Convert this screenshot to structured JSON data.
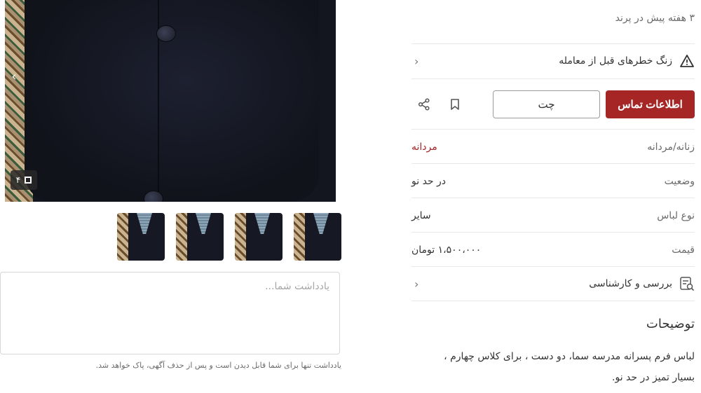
{
  "gallery": {
    "photo_count": "۴",
    "note_placeholder": "یادداشت شما...",
    "note_hint": "یادداشت تنها برای شما قابل دیدن است و پس از حذف آگهی، پاک خواهد شد."
  },
  "listing": {
    "posted_time": "۳ هفته پیش در پرند",
    "warning_label": "زنگ خطرهای قبل از معامله",
    "contact_label": "اطلاعات تماس",
    "chat_label": "چت",
    "attributes": [
      {
        "key": "زنانه/مردانه",
        "value": "مردانه"
      },
      {
        "key": "وضعیت",
        "value": "در حد نو"
      },
      {
        "key": "نوع لباس",
        "value": "سایر"
      },
      {
        "key": "قیمت",
        "value": "۱،۵۰۰،۰۰۰ تومان"
      }
    ],
    "review_label": "بررسی و کارشناسی",
    "description_title": "توضیحات",
    "description_line1": "لباس فرم پسرانه مدرسه سما، دو دست ، برای کلاس چهارم ،",
    "description_line2": "بسیار تمیز در حد نو."
  },
  "colors": {
    "accent": "#a62626",
    "border": "#e8e8e8",
    "muted_text": "#6b6b6b"
  }
}
